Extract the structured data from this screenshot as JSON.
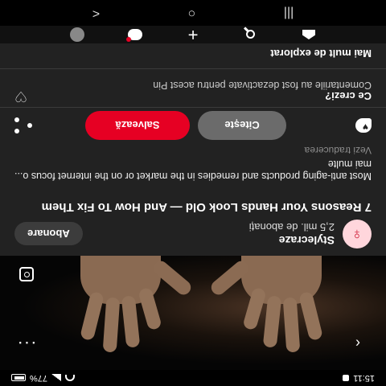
{
  "status": {
    "time": "15:11",
    "battery": "77%"
  },
  "pin": {
    "image_alt": "old wrinkled hands"
  },
  "creator": {
    "name": "Stylecraze",
    "followers": "2,5 mil. de abonați",
    "follow_label": "Abonare"
  },
  "title": "7 Reasons Your Hands Look Old — And How To Fix Them",
  "description": "Most anti-aging products and remedies in the market or on the internet focus o... mai multe",
  "translate_label": "Vezi traducerea",
  "actions": {
    "read_label": "Citește",
    "save_label": "Salvează"
  },
  "comments": {
    "title": "Ce crezi?",
    "disabled_text": "Comentariile au fost dezactivate pentru acest Pin"
  },
  "more_to_explore": "Mai mult de explorat",
  "system_nav": {
    "back": "<",
    "home": "○",
    "recents": "|||"
  },
  "colors": {
    "save_red": "#e60023",
    "card_bg": "#222222",
    "read_grey": "#6b6b6b",
    "avatar_bg": "#ffd6dc"
  }
}
